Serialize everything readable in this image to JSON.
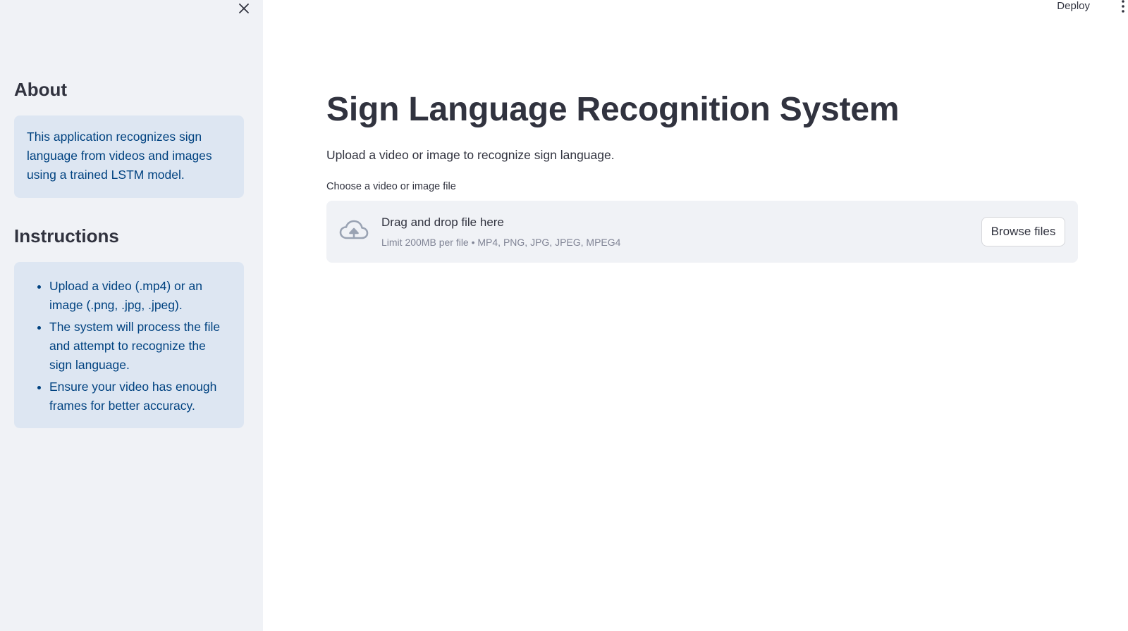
{
  "sidebar": {
    "about": {
      "heading": "About",
      "text": "This application recognizes sign language from videos and images using a trained LSTM model."
    },
    "instructions": {
      "heading": "Instructions",
      "items": [
        "Upload a video (.mp4) or an image (.png, .jpg, .jpeg).",
        "The system will process the file and attempt to recognize the sign language.",
        "Ensure your video has enough frames for better accuracy."
      ]
    },
    "close_icon": "close-icon"
  },
  "header": {
    "deploy_label": "Deploy",
    "menu_icon": "vertical-dots-icon"
  },
  "main": {
    "title": "Sign Language Recognition System",
    "subtitle": "Upload a video or image to recognize sign language.",
    "uploader": {
      "label": "Choose a video or image file",
      "drop_title": "Drag and drop file here",
      "limit_text": "Limit 200MB per file • MP4, PNG, JPG, JPEG, MPEG4",
      "browse_label": "Browse files",
      "icon": "cloud-upload-icon"
    }
  },
  "colors": {
    "sidebar_bg": "#f0f2f6",
    "info_bg": "#dde6f2",
    "info_text": "#004280",
    "text": "#31333f",
    "muted": "#808495"
  }
}
